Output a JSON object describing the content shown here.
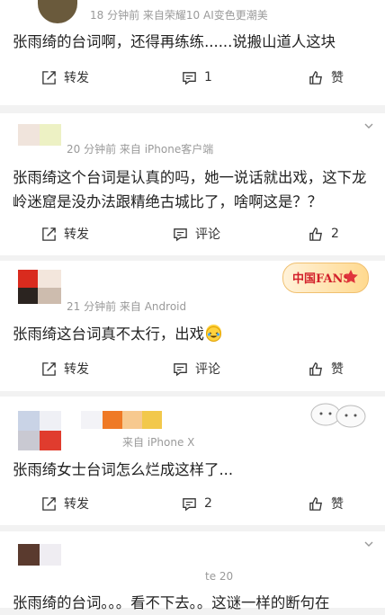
{
  "comments": [
    {
      "meta": "18 分钟前  来自荣耀10 AI变色更潮美",
      "text": "张雨绮的台词啊，还得再练练......说搬山道人这块",
      "repost": "转发",
      "comment": "1",
      "like": "赞"
    },
    {
      "meta": "20 分钟前  来自 iPhone客户端",
      "text": "张雨绮这个台词是认真的吗，她一说话就出戏，这下龙岭迷窟是没办法跟精绝古城比了，啥啊这是？？",
      "repost": "转发",
      "comment": "评论",
      "like": "2"
    },
    {
      "meta": "21 分钟前  来自 Android",
      "text": "张雨绮这台词真不太行，出戏",
      "repost": "转发",
      "comment": "评论",
      "like": "赞",
      "badge": "中国FANS"
    },
    {
      "meta": "来自 iPhone X",
      "text": "张雨绮女士台词怎么烂成这样了...",
      "repost": "转发",
      "comment": "2",
      "like": "赞"
    },
    {
      "meta": "te 20",
      "text": "张雨绮的台词。。。看不下去。。这谜一样的断句在"
    }
  ],
  "colors": {
    "background": "#f2f2f2",
    "card": "#ffffff",
    "text": "#222222",
    "meta": "#9a9a9a"
  },
  "icons": [
    "repost-icon",
    "comment-icon",
    "like-icon",
    "chevron-down-icon",
    "laugh-cry-emoji-icon"
  ]
}
